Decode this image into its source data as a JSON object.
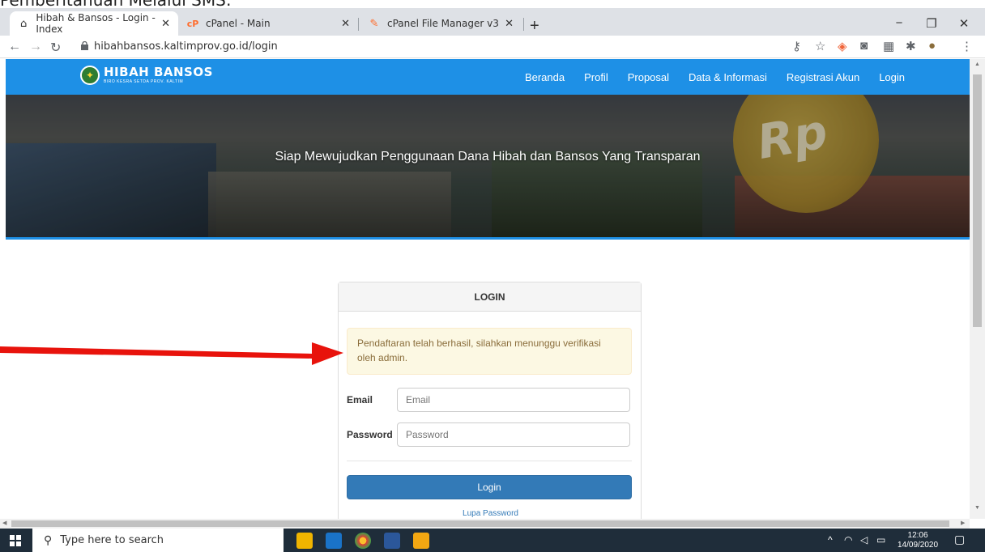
{
  "caption": "Pemberitahuan Melalui SMS:",
  "browser": {
    "tabs": [
      {
        "label": "Hibah & Bansos - Login - Index",
        "active": true
      },
      {
        "label": "cPanel - Main",
        "active": false
      },
      {
        "label": "cPanel File Manager v3",
        "active": false
      }
    ],
    "url": "hibahbansos.kaltimprov.go.id/login"
  },
  "site": {
    "brand_title": "HIBAH BANSOS",
    "brand_subtitle": "BIRO KESRA SETDA PROV. KALTIM",
    "nav": [
      "Beranda",
      "Profil",
      "Proposal",
      "Data & Informasi",
      "Registrasi Akun",
      "Login"
    ],
    "hero_title": "Siap Mewujudkan Penggunaan Dana Hibah dan Bansos Yang Transparan",
    "hero_coin": "Rp",
    "accent": "#1e90e6"
  },
  "login": {
    "heading": "LOGIN",
    "alert": "Pendaftaran telah berhasil, silahkan menunggu verifikasi oleh admin.",
    "email_label": "Email",
    "email_placeholder": "Email",
    "password_label": "Password",
    "password_placeholder": "Password",
    "button": "Login",
    "forgot": "Lupa Password"
  },
  "taskbar": {
    "search_placeholder": "Type here to search",
    "time": "12:06",
    "date": "14/09/2020"
  }
}
